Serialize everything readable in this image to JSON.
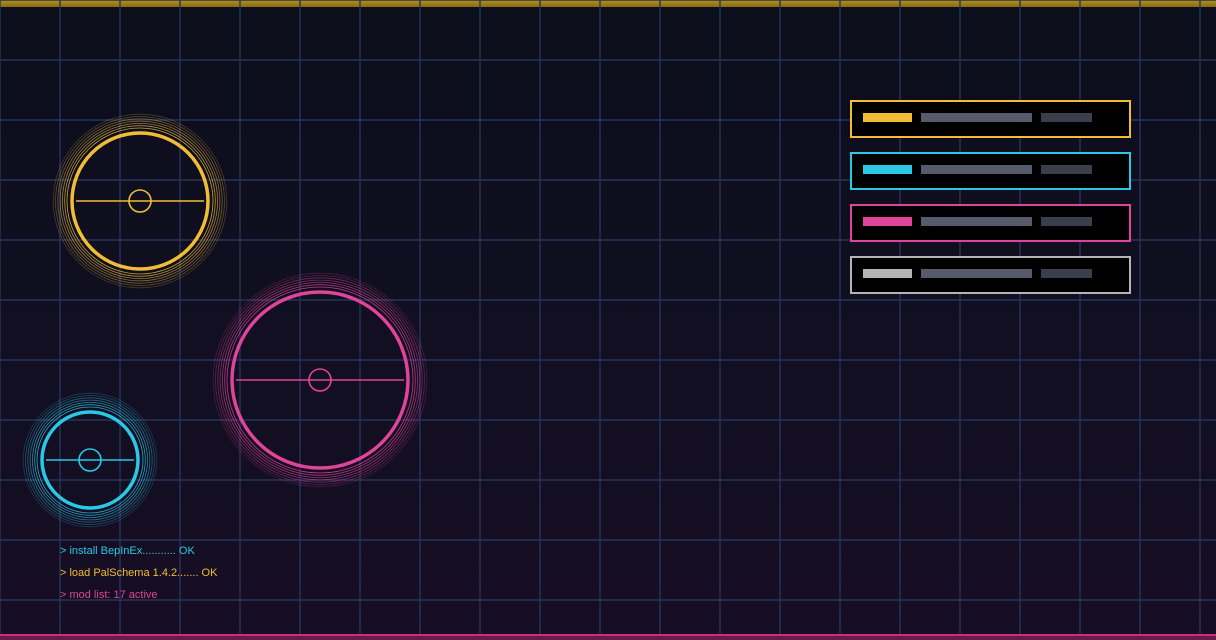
{
  "colors": {
    "gold": "#f2bd34",
    "cyan": "#29c9e6",
    "pink": "#e0449a",
    "silver": "#b4b4b4",
    "grid": "#27345a"
  },
  "panels": [
    {
      "accent": "#f2bd34"
    },
    {
      "accent": "#29c9e6"
    },
    {
      "accent": "#e0449a"
    },
    {
      "accent": "#b4b4b4"
    }
  ],
  "console": {
    "lines": [
      {
        "text": "> install BepInEx........... OK",
        "color": "#29c9e6"
      },
      {
        "text": "> load PalSchema 1.4.2....... OK",
        "color": "#f2bd34"
      },
      {
        "text": "> mod list: 17 active",
        "color": "#e0449a"
      }
    ]
  },
  "icons": [
    "gold-sphere-icon",
    "pink-sphere-icon",
    "cyan-sphere-icon"
  ]
}
